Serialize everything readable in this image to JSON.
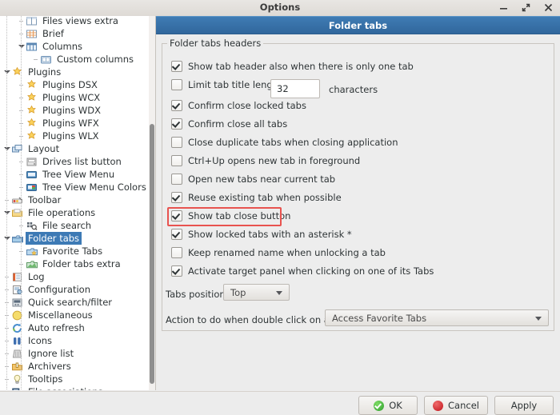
{
  "window": {
    "title": "Options",
    "buttons": [
      {
        "name": "minimize-button",
        "glyph": "minimize-icon"
      },
      {
        "name": "maximize-button",
        "glyph": "maximize-icon"
      },
      {
        "name": "close-button",
        "glyph": "close-icon"
      }
    ]
  },
  "sidebar": {
    "scrollbar": "vertical-scrollbar",
    "items": [
      {
        "label": "Files views extra",
        "depth": 2,
        "expander": "stub",
        "icon": "files-views-extra-icon",
        "selected": false
      },
      {
        "label": "Brief",
        "depth": 2,
        "expander": "stub",
        "icon": "brief-icon",
        "selected": false
      },
      {
        "label": "Columns",
        "depth": 2,
        "expander": "arrow",
        "icon": "columns-icon",
        "selected": false
      },
      {
        "label": "Custom columns",
        "depth": 3,
        "expander": "stub",
        "icon": "custom-columns-icon",
        "selected": false
      },
      {
        "label": "Plugins",
        "depth": 1,
        "expander": "arrow",
        "icon": "plugins-icon",
        "selected": false
      },
      {
        "label": "Plugins DSX",
        "depth": 2,
        "expander": "stub",
        "icon": "plugin-icon",
        "selected": false
      },
      {
        "label": "Plugins WCX",
        "depth": 2,
        "expander": "stub",
        "icon": "plugin-icon",
        "selected": false
      },
      {
        "label": "Plugins WDX",
        "depth": 2,
        "expander": "stub",
        "icon": "plugin-icon",
        "selected": false
      },
      {
        "label": "Plugins WFX",
        "depth": 2,
        "expander": "stub",
        "icon": "plugin-icon",
        "selected": false
      },
      {
        "label": "Plugins WLX",
        "depth": 2,
        "expander": "stub",
        "icon": "plugin-icon",
        "selected": false
      },
      {
        "label": "Layout",
        "depth": 1,
        "expander": "arrow",
        "icon": "layout-icon",
        "selected": false
      },
      {
        "label": "Drives list button",
        "depth": 2,
        "expander": "stub",
        "icon": "drives-list-button-icon",
        "selected": false
      },
      {
        "label": "Tree View Menu",
        "depth": 2,
        "expander": "stub",
        "icon": "tree-view-menu-icon",
        "selected": false
      },
      {
        "label": "Tree View Menu Colors",
        "depth": 2,
        "expander": "stub",
        "icon": "tree-view-menu-colors-icon",
        "selected": false
      },
      {
        "label": "Toolbar",
        "depth": 1,
        "expander": "stub",
        "icon": "toolbar-icon",
        "selected": false
      },
      {
        "label": "File operations",
        "depth": 1,
        "expander": "arrow",
        "icon": "file-operations-icon",
        "selected": false
      },
      {
        "label": "File search",
        "depth": 2,
        "expander": "stub",
        "icon": "file-search-icon",
        "selected": false
      },
      {
        "label": "Folder tabs",
        "depth": 1,
        "expander": "arrow",
        "icon": "folder-tabs-icon",
        "selected": true
      },
      {
        "label": "Favorite Tabs",
        "depth": 2,
        "expander": "stub",
        "icon": "favorite-tabs-icon",
        "selected": false
      },
      {
        "label": "Folder tabs extra",
        "depth": 2,
        "expander": "stub",
        "icon": "folder-tabs-extra-icon",
        "selected": false
      },
      {
        "label": "Log",
        "depth": 1,
        "expander": "stub",
        "icon": "log-icon",
        "selected": false
      },
      {
        "label": "Configuration",
        "depth": 1,
        "expander": "stub",
        "icon": "configuration-icon",
        "selected": false
      },
      {
        "label": "Quick search/filter",
        "depth": 1,
        "expander": "stub",
        "icon": "quick-search-filter-icon",
        "selected": false
      },
      {
        "label": "Miscellaneous",
        "depth": 1,
        "expander": "stub",
        "icon": "miscellaneous-icon",
        "selected": false
      },
      {
        "label": "Auto refresh",
        "depth": 1,
        "expander": "stub",
        "icon": "auto-refresh-icon",
        "selected": false
      },
      {
        "label": "Icons",
        "depth": 1,
        "expander": "stub",
        "icon": "icons-icon",
        "selected": false
      },
      {
        "label": "Ignore list",
        "depth": 1,
        "expander": "stub",
        "icon": "ignore-list-icon",
        "selected": false
      },
      {
        "label": "Archivers",
        "depth": 1,
        "expander": "stub",
        "icon": "archivers-icon",
        "selected": false
      },
      {
        "label": "Tooltips",
        "depth": 1,
        "expander": "stub",
        "icon": "tooltips-icon",
        "selected": false
      },
      {
        "label": "File associations",
        "depth": 1,
        "expander": "arrow",
        "icon": "file-associations-icon",
        "selected": false
      }
    ]
  },
  "page": {
    "header": "Folder tabs",
    "group_legend": "Folder tabs headers",
    "checkboxes": [
      {
        "label": "Show tab header also when there is only one tab",
        "checked": true,
        "highlighted": false
      },
      {
        "label": "Limit tab title length to",
        "checked": false,
        "highlighted": false
      },
      {
        "label": "Confirm close locked tabs",
        "checked": true,
        "highlighted": false
      },
      {
        "label": "Confirm close all tabs",
        "checked": true,
        "highlighted": false
      },
      {
        "label": "Close duplicate tabs when closing application",
        "checked": false,
        "highlighted": false
      },
      {
        "label": "Ctrl+Up opens new tab in foreground",
        "checked": false,
        "highlighted": false
      },
      {
        "label": "Open new tabs near current tab",
        "checked": false,
        "highlighted": false
      },
      {
        "label": "Reuse existing tab when possible",
        "checked": true,
        "highlighted": false
      },
      {
        "label": "Show tab close button",
        "checked": true,
        "highlighted": true
      },
      {
        "label": "Show locked tabs with an asterisk *",
        "checked": true,
        "highlighted": false
      },
      {
        "label": "Keep renamed name when unlocking a tab",
        "checked": false,
        "highlighted": false
      },
      {
        "label": "Activate target panel when clicking on one of its Tabs",
        "checked": true,
        "highlighted": false
      }
    ],
    "limit_length_value": "32",
    "limit_length_suffix": "characters",
    "tabs_position_label": "Tabs position",
    "tabs_position_value": "Top",
    "double_click_label": "Action to do when double click on a tab:",
    "double_click_value": "Access Favorite Tabs",
    "highlight_color": "#e8534f"
  },
  "footer": {
    "ok_label": "OK",
    "cancel_label": "Cancel",
    "apply_label": "Apply"
  }
}
